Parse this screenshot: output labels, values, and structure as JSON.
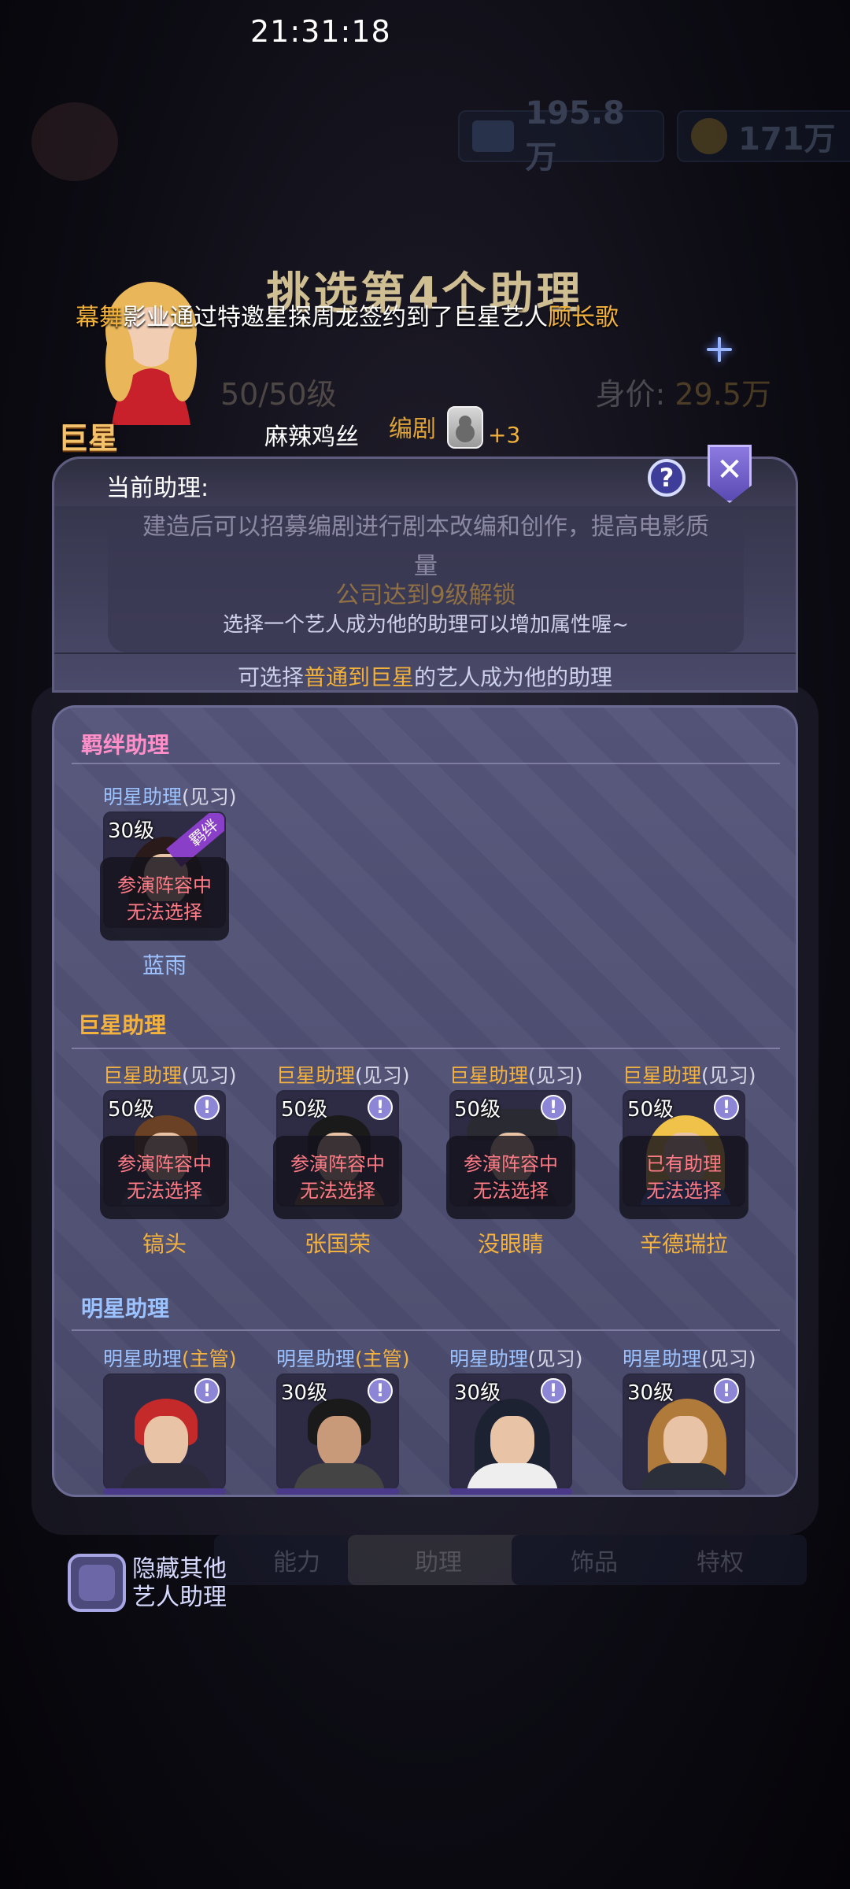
{
  "status_bar": {
    "time": "21:31:18"
  },
  "background": {
    "currency": [
      "195.8万",
      "171万"
    ],
    "level": "50/50级",
    "price_label": "身价:",
    "price_value": "29.5万",
    "tabs": [
      "能力",
      "助理",
      "饰品",
      "特权"
    ]
  },
  "banner": {
    "title": "挑选第4个助理",
    "text_studio": "幕舞",
    "text_middle": "影业通过特邀星探周龙签约到了巨星艺人",
    "text_artist": "顾长歌"
  },
  "header": {
    "tier": "巨星",
    "assistant_name": "麻辣鸡丝",
    "role": "编剧",
    "bonus": "+3"
  },
  "popup": {
    "current_label": "当前助理:",
    "help": "?",
    "close": "✕",
    "locked_desc": "建造后可以招募编剧进行剧本改编和创作，提高电影质量",
    "locked_req": "公司达到9级解锁",
    "select_hint": "选择一个艺人成为他的助理可以增加属性喔~",
    "range_prefix": "可选择",
    "range_highlight": "普通到巨星",
    "range_suffix": "的艺人成为他的助理"
  },
  "sections": {
    "bond": "羁绊助理",
    "superstar": "巨星助理",
    "star": "明星助理"
  },
  "bond_card": {
    "type": "明星助理",
    "rank": "(见习)",
    "level": "30级",
    "ribbon": "羁绊",
    "status1": "参演阵容中",
    "status2": "无法选择",
    "name": "蓝雨"
  },
  "superstar_cards": [
    {
      "type": "巨星助理",
      "rank": "(见习)",
      "level": "50级",
      "status1": "参演阵容中",
      "status2": "无法选择",
      "name": "镐头"
    },
    {
      "type": "巨星助理",
      "rank": "(见习)",
      "level": "50级",
      "status1": "参演阵容中",
      "status2": "无法选择",
      "name": "张国荣"
    },
    {
      "type": "巨星助理",
      "rank": "(见习)",
      "level": "50级",
      "status1": "参演阵容中",
      "status2": "无法选择",
      "name": "没眼睛"
    },
    {
      "type": "巨星助理",
      "rank": "(见习)",
      "level": "50级",
      "status1": "已有助理",
      "status2": "无法选择",
      "name": "辛德瑞拉"
    }
  ],
  "star_cards": [
    {
      "type": "明星助理",
      "rank": "(主管)",
      "level": ""
    },
    {
      "type": "明星助理",
      "rank": "(主管)",
      "level": "30级"
    },
    {
      "type": "明星助理",
      "rank": "(见习)",
      "level": "30级"
    },
    {
      "type": "明星助理",
      "rank": "(见习)",
      "level": "30级"
    }
  ],
  "hide_toggle": {
    "line1": "隐藏其他",
    "line2": "艺人助理"
  },
  "colors": {
    "gold": "#f3b23f",
    "blue": "#9cc3ff",
    "red_status": "#ff7b86",
    "panel": "#4a4a6c"
  }
}
